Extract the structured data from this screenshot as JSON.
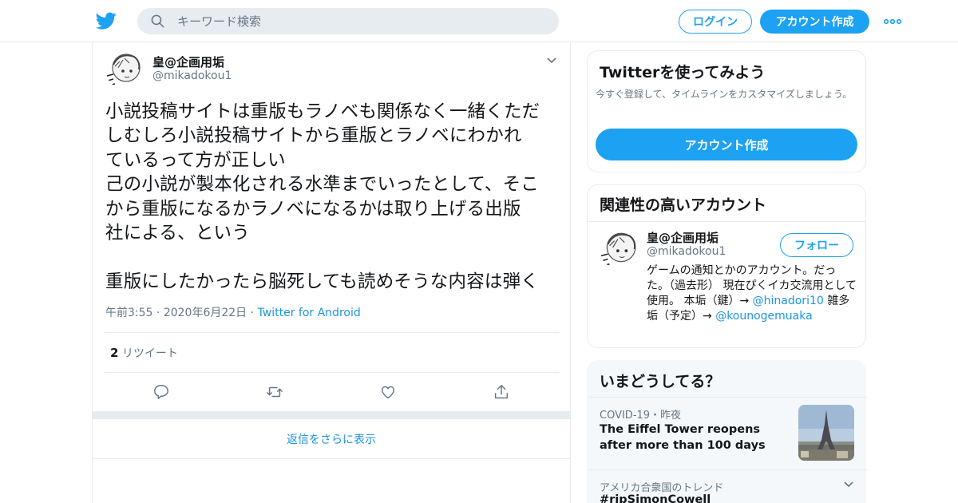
{
  "header": {
    "search_placeholder": "キーワード検索",
    "login_label": "ログイン",
    "signup_label": "アカウント作成",
    "brand_color": "#1da1f2"
  },
  "tweet": {
    "author_name": "皇@企画用垢",
    "author_handle": "@mikadokou1",
    "text": "小説投稿サイトは重版もラノベも関係なく一緒くただ\nしむしろ小説投稿サイトから重版とラノベにわかれ\nているって方が正しい\n己の小説が製本化される水準までいったとして、そこ\nから重版になるかラノベになるかは取り上げる出版\n社による、という\n\n重版にしたかったら脳死しても読めそうな内容は弾く",
    "time": "午前3:55",
    "date": "2020年6月22日",
    "source": "Twitter for Android",
    "retweet_count": "2",
    "retweet_label": "リツイート",
    "more_replies_label": "返信をさらに表示"
  },
  "sidebar": {
    "signup_card": {
      "title": "Twitterを使ってみよう",
      "subtitle": "今すぐ登録して、タイムラインをカスタマイズしましょう。",
      "cta_label": "アカウント作成"
    },
    "related": {
      "title": "関連性の高いアカウント",
      "name": "皇@企画用垢",
      "handle": "@mikadokou1",
      "follow_label": "フォロー",
      "bio_text": "ゲームの通知とかのアカウント。だった。（過去形） 現在ぴくイカ交流用として使用。 本垢（鍵）→ ",
      "bio_link1": "@hinadori10",
      "bio_mid": " 雑多垢（予定）→ ",
      "bio_link2": "@kounogemuaka"
    },
    "trends": {
      "title": "いまどうしてる？",
      "item1_category": "COVID-19・昨夜",
      "item1_headline": "The Eiffel Tower reopens after more than 100 days",
      "item2_category": "アメリカ合衆国のトレンド",
      "item2_trend": "#ripSimonCowell"
    }
  }
}
